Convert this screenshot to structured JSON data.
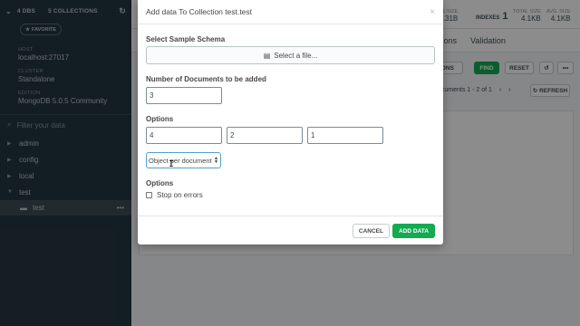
{
  "sidebar": {
    "db_count": "4 DBS",
    "collection_count": "5 COLLECTIONS",
    "favorite_label": "FAVORITE",
    "host_label": "HOST",
    "host_value": "localhost:27017",
    "cluster_label": "CLUSTER",
    "cluster_value": "Standalone",
    "edition_label": "EDITION",
    "edition_value": "MongoDB 5.0.5 Community",
    "filter_placeholder": "Filter your data",
    "databases": [
      "admin",
      "config",
      "local",
      "test"
    ],
    "active_collection": "test"
  },
  "main": {
    "total_size_partial_label": "AL SIZE",
    "total_size_partial_value": ".31B",
    "indexes_label": "INDEXES",
    "indexes_value": "1",
    "total_size_label": "TOTAL SIZE",
    "total_size_value": "4.1KB",
    "avg_size_label": "AVG. SIZE",
    "avg_size_value": "4.1KB",
    "tab_partial": "ations",
    "tab_validation": "Validation",
    "options_partial": "IONS",
    "find_label": "FIND",
    "reset_label": "RESET",
    "pager_text": "ocuments 1 - 2 of 1",
    "refresh_label": "REFRESH"
  },
  "modal": {
    "title": "Add data To Collection test.test",
    "schema_label": "Select Sample Schema",
    "file_button_label": "Select a file...",
    "num_docs_label": "Number of Documents to be added",
    "num_docs_value": "3",
    "options_label": "Options",
    "option_values": [
      "4",
      "2",
      "1"
    ],
    "mode_select_value": "Object per document",
    "options2_label": "Options",
    "stop_on_errors_label": "Stop on errors",
    "cancel_label": "CANCEL",
    "add_label": "ADD DATA"
  },
  "colors": {
    "sidebar_bg": "#243642",
    "accent_green": "#13aa52",
    "focus_blue": "#4fa0d4"
  }
}
